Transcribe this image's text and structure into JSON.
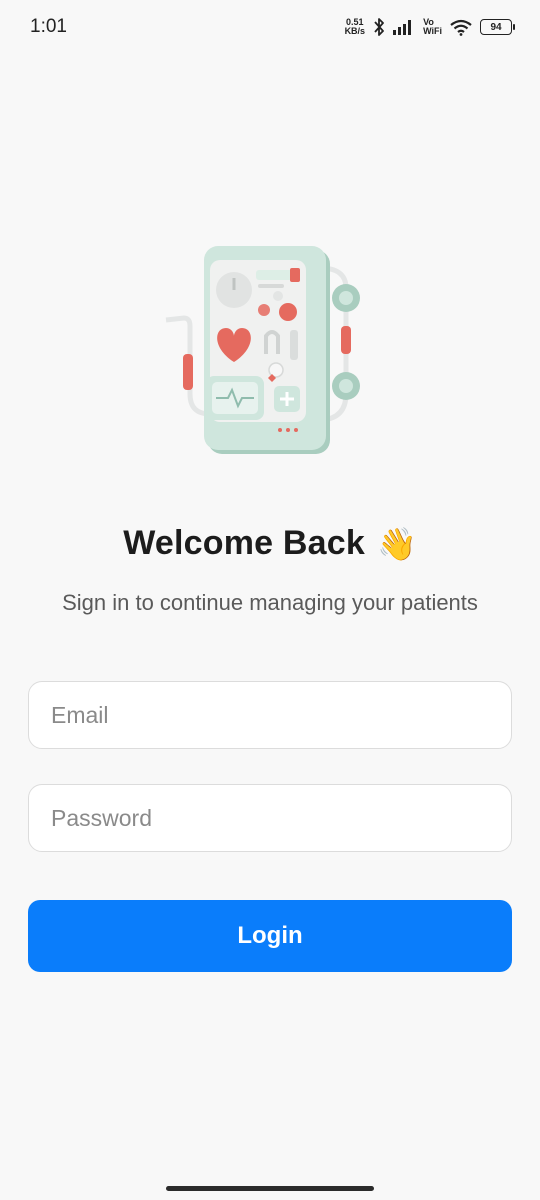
{
  "status_bar": {
    "time": "1:01",
    "net_speed_value": "0.51",
    "net_speed_unit": "KB/s",
    "vo_label": "Vo",
    "wifi_label": "WiFi",
    "battery": "94",
    "icons": [
      "bluetooth-icon",
      "signal-icon",
      "wifi-icon",
      "battery-icon"
    ]
  },
  "illustration": {
    "name": "medical-device-illustration"
  },
  "welcome": {
    "title": "Welcome Back",
    "emoji": "👋",
    "subtitle": "Sign in to continue managing your patients"
  },
  "form": {
    "email_placeholder": "Email",
    "password_placeholder": "Password",
    "login_label": "Login"
  },
  "colors": {
    "background": "#f8f8f8",
    "accent": "#0a7dfb",
    "illustration_mint": "#cfe6dd",
    "illustration_red": "#e56a5f"
  }
}
